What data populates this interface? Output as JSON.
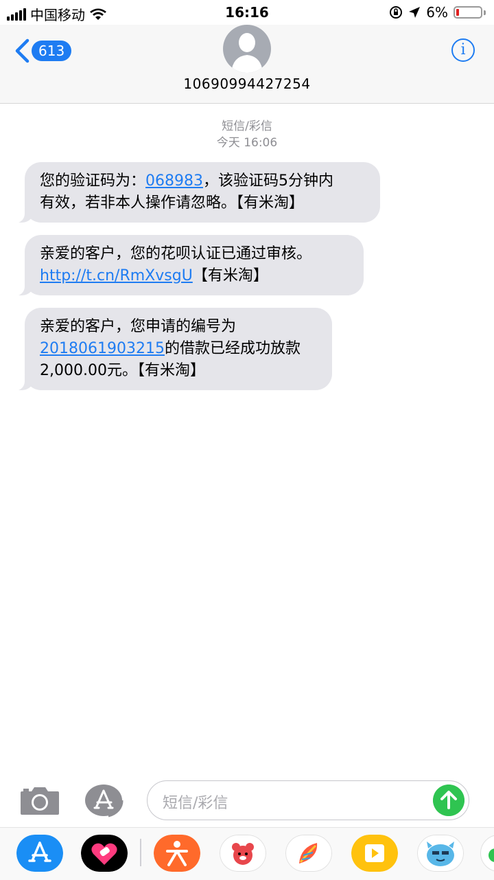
{
  "status_bar": {
    "carrier": "中国移动",
    "time": "16:16",
    "battery": "6%"
  },
  "header": {
    "back_count": "613",
    "contact_number": "10690994427254"
  },
  "conversation": {
    "label": "短信/彩信",
    "timestamp": "今天 16:06",
    "messages": [
      {
        "p1": "您的验证码为：",
        "link": "068983",
        "p2": "，该验证码5分钟内",
        "p3": "有效，若非本人操作请忽略。【有米淘】"
      },
      {
        "p1": "亲爱的客户，您的花呗认证已通过审核。",
        "link": "http://t.cn/RmXvsgU",
        "p2": "【有米淘】"
      },
      {
        "p1": "亲爱的客户，您申请的编号为",
        "link": "2018061903215",
        "p2": "的借款已经成功放款",
        "p3": "2,000.00元。【有米淘】"
      }
    ]
  },
  "input": {
    "placeholder": "短信/彩信"
  },
  "colors": {
    "accent": "#1e7cf2",
    "bubble": "#e5e5ea",
    "send": "#2fc451",
    "battery_low": "#e02020"
  },
  "app_drawer": [
    "app-store-icon",
    "fitness-heart-icon",
    "dianping-icon",
    "bear-sticker-icon",
    "feather-app-icon",
    "video-app-icon",
    "monster-sticker-icon"
  ]
}
